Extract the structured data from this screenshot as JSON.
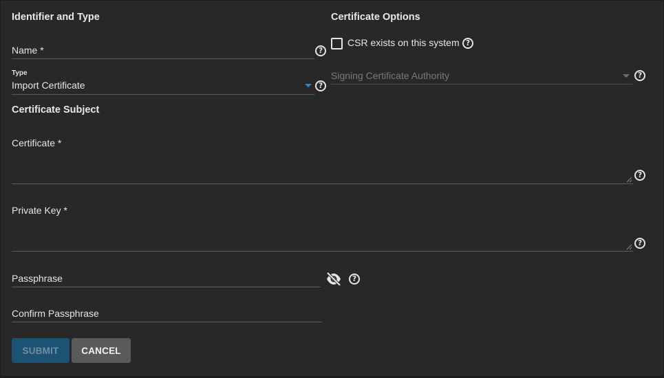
{
  "sections": {
    "identifier_type": "Identifier and Type",
    "certificate_options": "Certificate Options",
    "certificate_subject": "Certificate Subject"
  },
  "fields": {
    "name": {
      "label": "Name *"
    },
    "type": {
      "label": "Type",
      "value": "Import Certificate"
    },
    "csr_exists": {
      "label": "CSR exists on this system",
      "checked": false
    },
    "signing_ca": {
      "placeholder": "Signing Certificate Authority"
    },
    "certificate": {
      "label": "Certificate *"
    },
    "private_key": {
      "label": "Private Key *"
    },
    "passphrase": {
      "label": "Passphrase"
    },
    "confirm_passphrase": {
      "label": "Confirm Passphrase"
    }
  },
  "buttons": {
    "submit": "SUBMIT",
    "cancel": "CANCEL"
  },
  "icons": {
    "help": "help-circle-icon",
    "visibility": "eye-off-icon",
    "dropdown": "caret-down-icon"
  },
  "colors": {
    "background": "#282828",
    "accent": "#1f6f9b",
    "submit_bg": "#1c5274",
    "cancel_bg": "#5a5a5a"
  }
}
